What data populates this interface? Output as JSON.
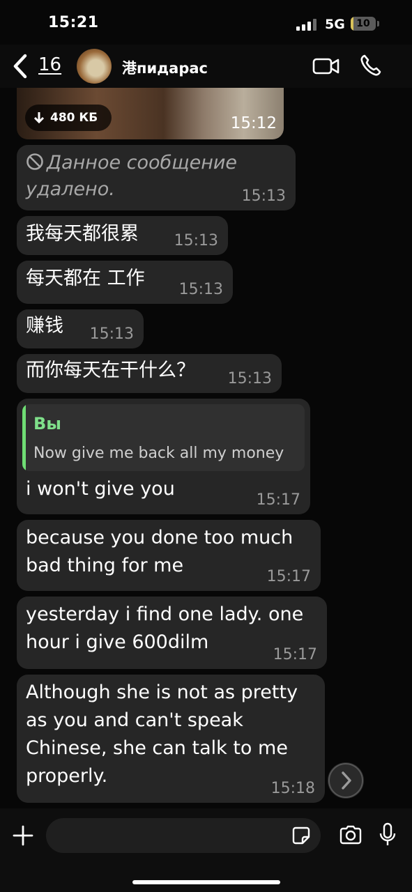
{
  "status_bar": {
    "time": "15:21",
    "network": "5G",
    "battery": "10",
    "battery_level": 0.1
  },
  "header": {
    "back_count": "16",
    "contact_name": "港пидарас"
  },
  "media": {
    "size": "480 КБ",
    "time": "15:12"
  },
  "messages": [
    {
      "text": "Данное сообщение удалено.",
      "time": "15:13",
      "deleted": true
    },
    {
      "text": "我每天都很累",
      "time": "15:13"
    },
    {
      "text": "每天都在 工作",
      "time": "15:13"
    },
    {
      "text": "赚钱",
      "time": "15:13"
    },
    {
      "text": "而你每天在干什么？",
      "time": "15:13"
    },
    {
      "reply_to": {
        "name": "Вы",
        "text": "Now give me back all my money"
      },
      "text": "i won't give you",
      "time": "15:17"
    },
    {
      "lines": [
        "because you done too much",
        "bad thing for me"
      ],
      "time": "15:17"
    },
    {
      "lines": [
        "yesterday i find one lady. one",
        "hour i give 600dilm"
      ],
      "time": "15:17"
    },
    {
      "lines": [
        "Although she is not as pretty",
        "as you and can't speak",
        "Chinese, she can talk to me",
        "properly."
      ],
      "time": "15:18"
    }
  ],
  "composer": {
    "placeholder": ""
  },
  "colors": {
    "bubble": "#262626",
    "background": "#070707",
    "quote_accent": "#6fdd74"
  }
}
